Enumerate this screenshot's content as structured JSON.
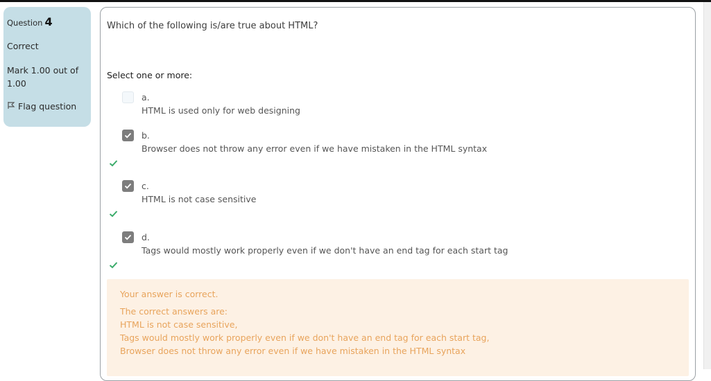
{
  "info": {
    "question_label": "Question",
    "question_number": "4",
    "state": "Correct",
    "grade": "Mark 1.00 out of 1.00",
    "flag_label": "Flag question"
  },
  "question": {
    "text": "Which of the following is/are true about HTML?",
    "prompt": "Select one or more:",
    "options": [
      {
        "letter": "a.",
        "text": "HTML is used only for web designing",
        "checked": false,
        "correct": false
      },
      {
        "letter": "b.",
        "text": "Browser does not throw any error even if we have mistaken in the HTML syntax",
        "checked": true,
        "correct": true
      },
      {
        "letter": "c.",
        "text": "HTML is not case sensitive",
        "checked": true,
        "correct": true
      },
      {
        "letter": "d.",
        "text": "Tags would mostly work properly even if we don't have an end tag for each start tag",
        "checked": true,
        "correct": true
      }
    ]
  },
  "feedback": {
    "result": "Your answer is correct.",
    "correct_header": "The correct answers are:",
    "answers": [
      "HTML is not case sensitive,",
      "Tags would mostly work properly even if we don't have an end tag for each start tag,",
      "Browser does not throw any error even if we have mistaken in the HTML syntax"
    ]
  },
  "colors": {
    "info_bg": "#c5dee6",
    "checkbox_checked": "#7d7d7d",
    "correct_tick": "#3aab6a",
    "feedback_bg": "#fdf1e4",
    "feedback_text": "#e8a45c"
  }
}
